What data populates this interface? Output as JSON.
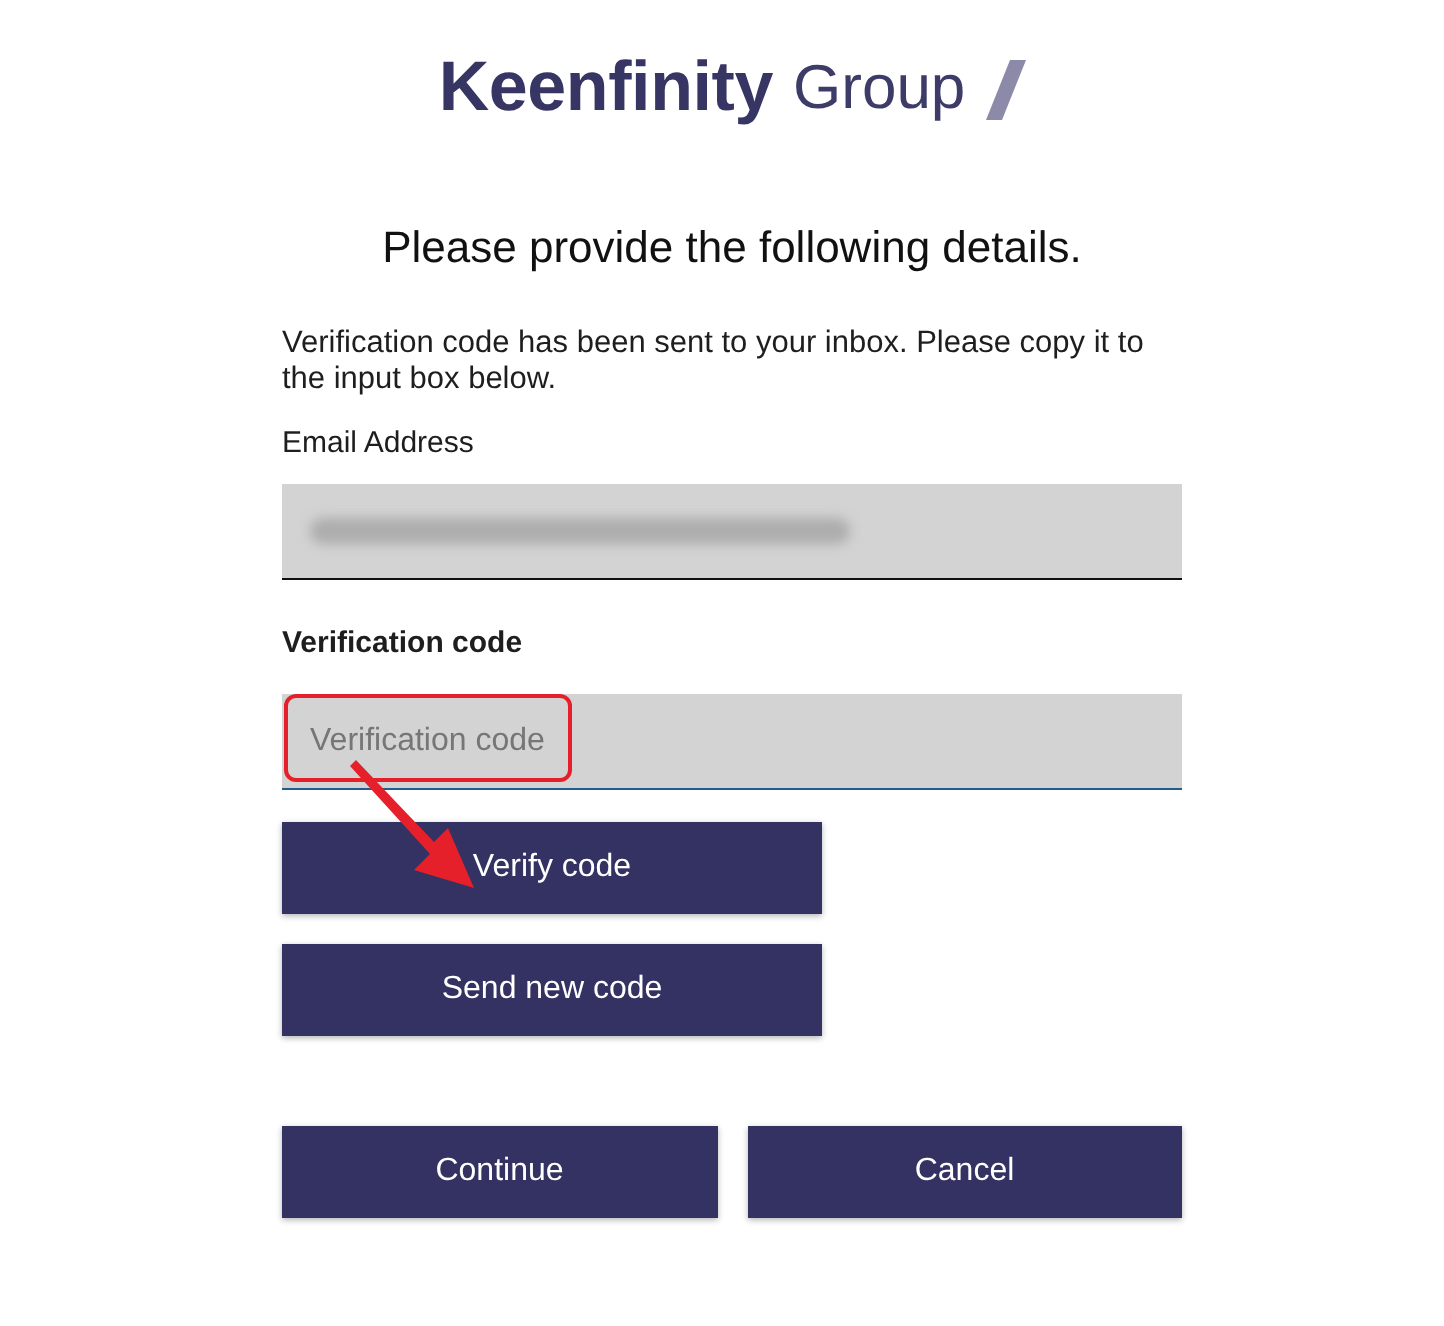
{
  "logo": {
    "brand": "Keenfinity",
    "suffix": "Group"
  },
  "heading": "Please provide the following details.",
  "intro": "Verification code has been sent to your inbox. Please copy it to the input box below.",
  "fields": [
    {
      "kind": "email",
      "label": "Email Address",
      "redacted": true,
      "focused": false
    },
    {
      "kind": "code",
      "label": "Verification code",
      "placeholder": "Verification code",
      "focused": true
    }
  ],
  "code_buttons": [
    {
      "label": "Verify code"
    },
    {
      "label": "Send new code"
    }
  ],
  "actions": [
    {
      "label": "Continue"
    },
    {
      "label": "Cancel"
    }
  ],
  "annotations": {
    "highlight": true,
    "arrow": true
  }
}
